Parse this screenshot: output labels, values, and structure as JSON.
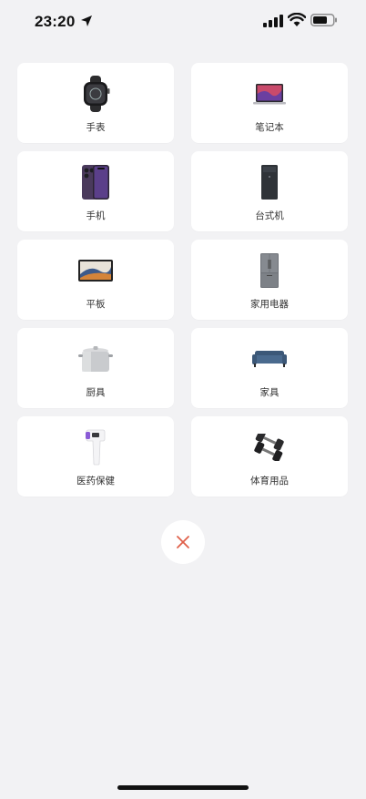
{
  "status": {
    "time": "23:20"
  },
  "categories": [
    {
      "label": "手表",
      "icon": "watch-icon"
    },
    {
      "label": "笔记本",
      "icon": "laptop-icon"
    },
    {
      "label": "手机",
      "icon": "phone-icon"
    },
    {
      "label": "台式机",
      "icon": "desktop-icon"
    },
    {
      "label": "平板",
      "icon": "tablet-icon"
    },
    {
      "label": "家用电器",
      "icon": "fridge-icon"
    },
    {
      "label": "厨具",
      "icon": "pot-icon"
    },
    {
      "label": "家具",
      "icon": "sofa-icon"
    },
    {
      "label": "医药保健",
      "icon": "thermometer-icon"
    },
    {
      "label": "体育用品",
      "icon": "dumbbell-icon"
    }
  ],
  "colors": {
    "close": "#e0604a",
    "background": "#f2f2f4"
  }
}
